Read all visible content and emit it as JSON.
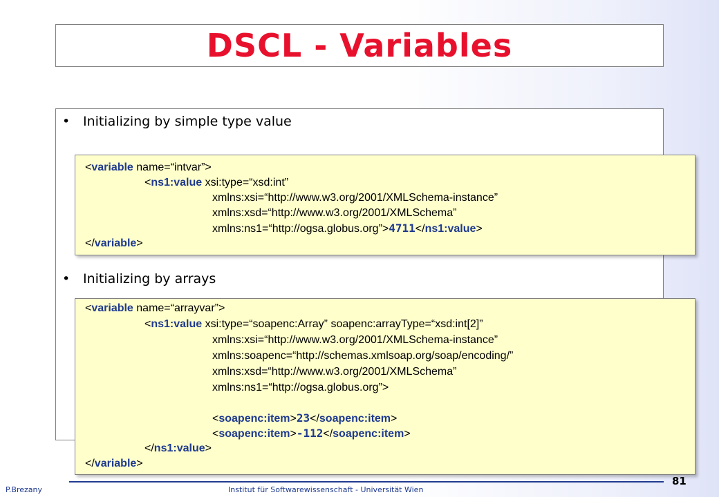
{
  "slide": {
    "title": "DSCL - Variables",
    "bullet1": "Initializing by simple type value",
    "bullet2": "Initializing by arrays",
    "bullet_glyph": "•"
  },
  "code1": {
    "l1": {
      "a": "<",
      "kw": "variable",
      "b": " name=“intvar”>"
    },
    "l2": {
      "a": "<",
      "kw": "ns1:value",
      "b": " xsi:type=“xsd:int”"
    },
    "l3": "xmlns:xsi=“http://www.w3.org/2001/XMLSchema-instance”",
    "l4": "xmlns:xsd=“http://www.w3.org/2001/XMLSchema”",
    "l5": {
      "a": "xmlns:ns1=“http://ogsa.globus.org”>",
      "val": "4711",
      "c": "</",
      "kw": "ns1:value",
      "d": ">"
    },
    "l6": {
      "a": "</",
      "kw": "variable",
      "b": ">"
    }
  },
  "code2": {
    "l1": {
      "a": "<",
      "kw": "variable",
      "b": " name=“arrayvar”>"
    },
    "l2": {
      "a": "<",
      "kw": "ns1:value",
      "b": " xsi:type=“soapenc:Array” soapenc:arrayType=“xsd:int[2]”"
    },
    "l3": "xmlns:xsi=“http://www.w3.org/2001/XMLSchema-instance”",
    "l4": "xmlns:soapenc=“http://schemas.xmlsoap.org/soap/encoding/”",
    "l5": "xmlns:xsd=“http://www.w3.org/2001/XMLSchema”",
    "l6": "xmlns:ns1=“http://ogsa.globus.org”>",
    "l7": {
      "a": "<",
      "kw1": "soapenc:item",
      "b": ">",
      "val": "23",
      "c": "</",
      "kw2": "soapenc:item",
      "d": ">"
    },
    "l8": {
      "a": "<",
      "kw1": "soapenc:item",
      "b": ">",
      "val": "-112",
      "c": "</",
      "kw2": "soapenc:item",
      "d": ">"
    },
    "l9": {
      "a": "</",
      "kw": "ns1:value",
      "b": ">"
    },
    "l10": {
      "a": "</",
      "kw": "variable",
      "b": ">"
    }
  },
  "footer": {
    "author": "P.Brezany",
    "institute": "Institut für Softwarewissenschaft - Universität Wien",
    "page": "81"
  },
  "colors": {
    "title": "#e8112d",
    "keyword": "#1f3a8f",
    "code_bg": "#ffffcc"
  }
}
